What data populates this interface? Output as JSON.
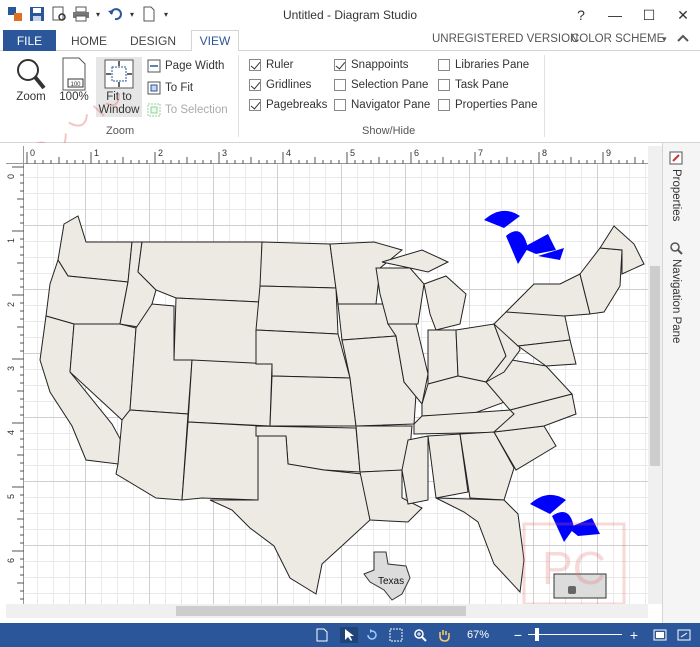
{
  "window": {
    "title": "Untitled - Diagram Studio",
    "controls": [
      "?",
      "—",
      "☐",
      "✕"
    ]
  },
  "ribbon_tabs": {
    "file": "FILE",
    "home": "HOME",
    "design": "DESIGN",
    "view": "VIEW",
    "unregistered": "UNREGISTERED VERSION",
    "color_scheme": "COLOR SCHEME"
  },
  "zoom_group": {
    "label": "Zoom",
    "zoom": "Zoom",
    "hundred": "100%",
    "fit_to_window_line1": "Fit to",
    "fit_to_window_line2": "Window",
    "page_width": "Page Width",
    "to_fit": "To Fit",
    "to_selection": "To Selection"
  },
  "showhide_group": {
    "label": "Show/Hide",
    "items": [
      {
        "label": "Ruler",
        "checked": true
      },
      {
        "label": "Gridlines",
        "checked": true
      },
      {
        "label": "Pagebreaks",
        "checked": true
      },
      {
        "label": "Snappoints",
        "checked": true
      },
      {
        "label": "Selection Pane",
        "checked": false
      },
      {
        "label": "Navigator Pane",
        "checked": false
      },
      {
        "label": "Libraries Pane",
        "checked": false
      },
      {
        "label": "Task Pane",
        "checked": false
      },
      {
        "label": "Properties Pane",
        "checked": false
      }
    ]
  },
  "rulers": {
    "horizontal": [
      "0",
      "1",
      "2",
      "3",
      "4",
      "5",
      "6",
      "7",
      "8",
      "9"
    ],
    "vertical": [
      "0",
      "1",
      "2",
      "3",
      "4",
      "5",
      "6"
    ]
  },
  "side_panes": {
    "properties": "Properties",
    "navigation": "Navigation Pane"
  },
  "diagram": {
    "shape_label": "Texas"
  },
  "statusbar": {
    "zoom_level": "67%",
    "minus": "−",
    "plus": "+"
  },
  "colors": {
    "accent": "#2b579a",
    "state_fill": "#eceae2",
    "lakes": "#0000ff"
  }
}
